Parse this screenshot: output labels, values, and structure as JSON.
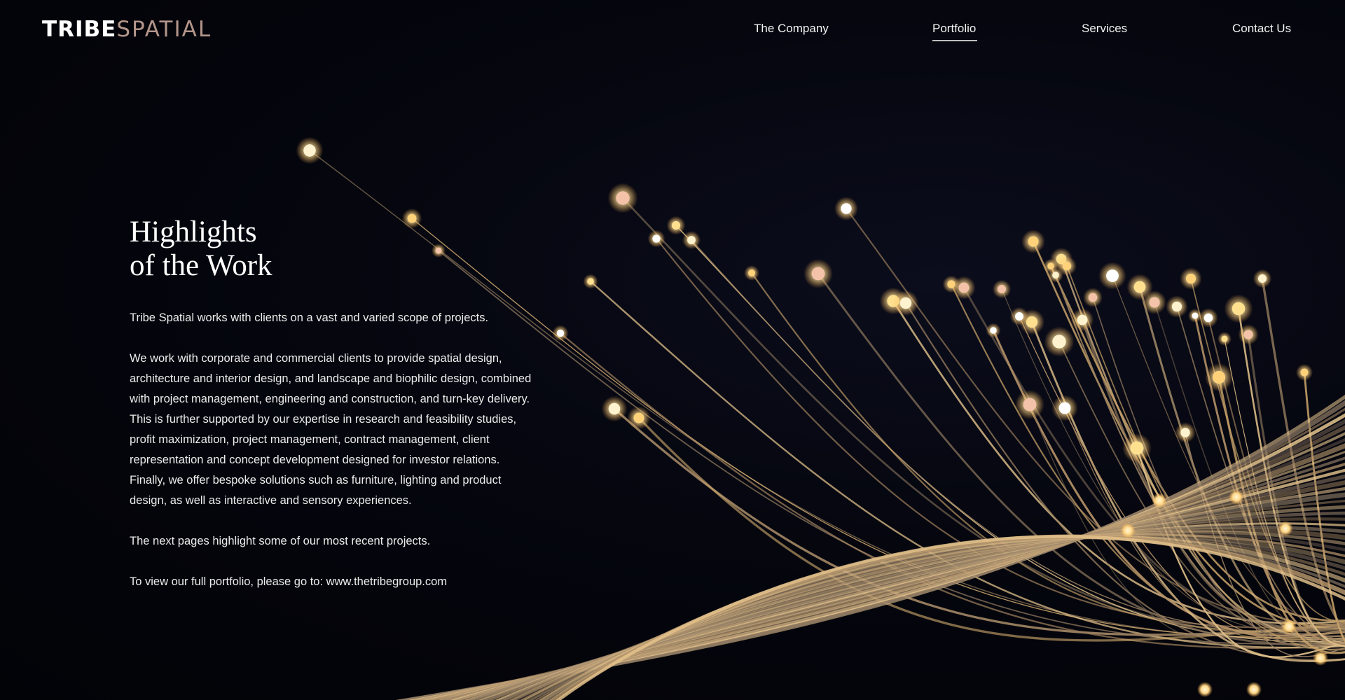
{
  "header": {
    "logo_part1": "TRIBE",
    "logo_part2": "SPATIAL",
    "nav": [
      {
        "label": "The Company"
      },
      {
        "label": "Portfolio",
        "active": true
      },
      {
        "label": "Services"
      },
      {
        "label": "Contact Us"
      }
    ]
  },
  "main": {
    "title_line1": "Highlights",
    "title_line2": "of the Work",
    "paragraphs": [
      "Tribe Spatial works with clients on a vast and varied scope of projects.",
      "We work with corporate and commercial clients to provide spatial design, architecture and interior design, and landscape and biophilic design, combined with project management, engineering and construction, and turn-key delivery.",
      "This is further supported by our expertise in research and feasibility studies, profit maximization, project management, contract management, client representation and concept development designed for investor relations.",
      "Finally, we offer bespoke solutions such as furniture, lighting and product design, as well as interactive and sensory experiences.",
      "The next pages highlight some of our most recent projects.",
      "To view our full portfolio, please go to: www.thetribegroup.com"
    ]
  },
  "colors": {
    "background": "#03040a",
    "text": "#ffffff",
    "logo_accent": "#b3958a",
    "fiber_gold": "#c9a46a",
    "fiber_glow": "#ffe6a8"
  },
  "hero_image": {
    "description_icon": "fiber-optic-strands-art"
  }
}
